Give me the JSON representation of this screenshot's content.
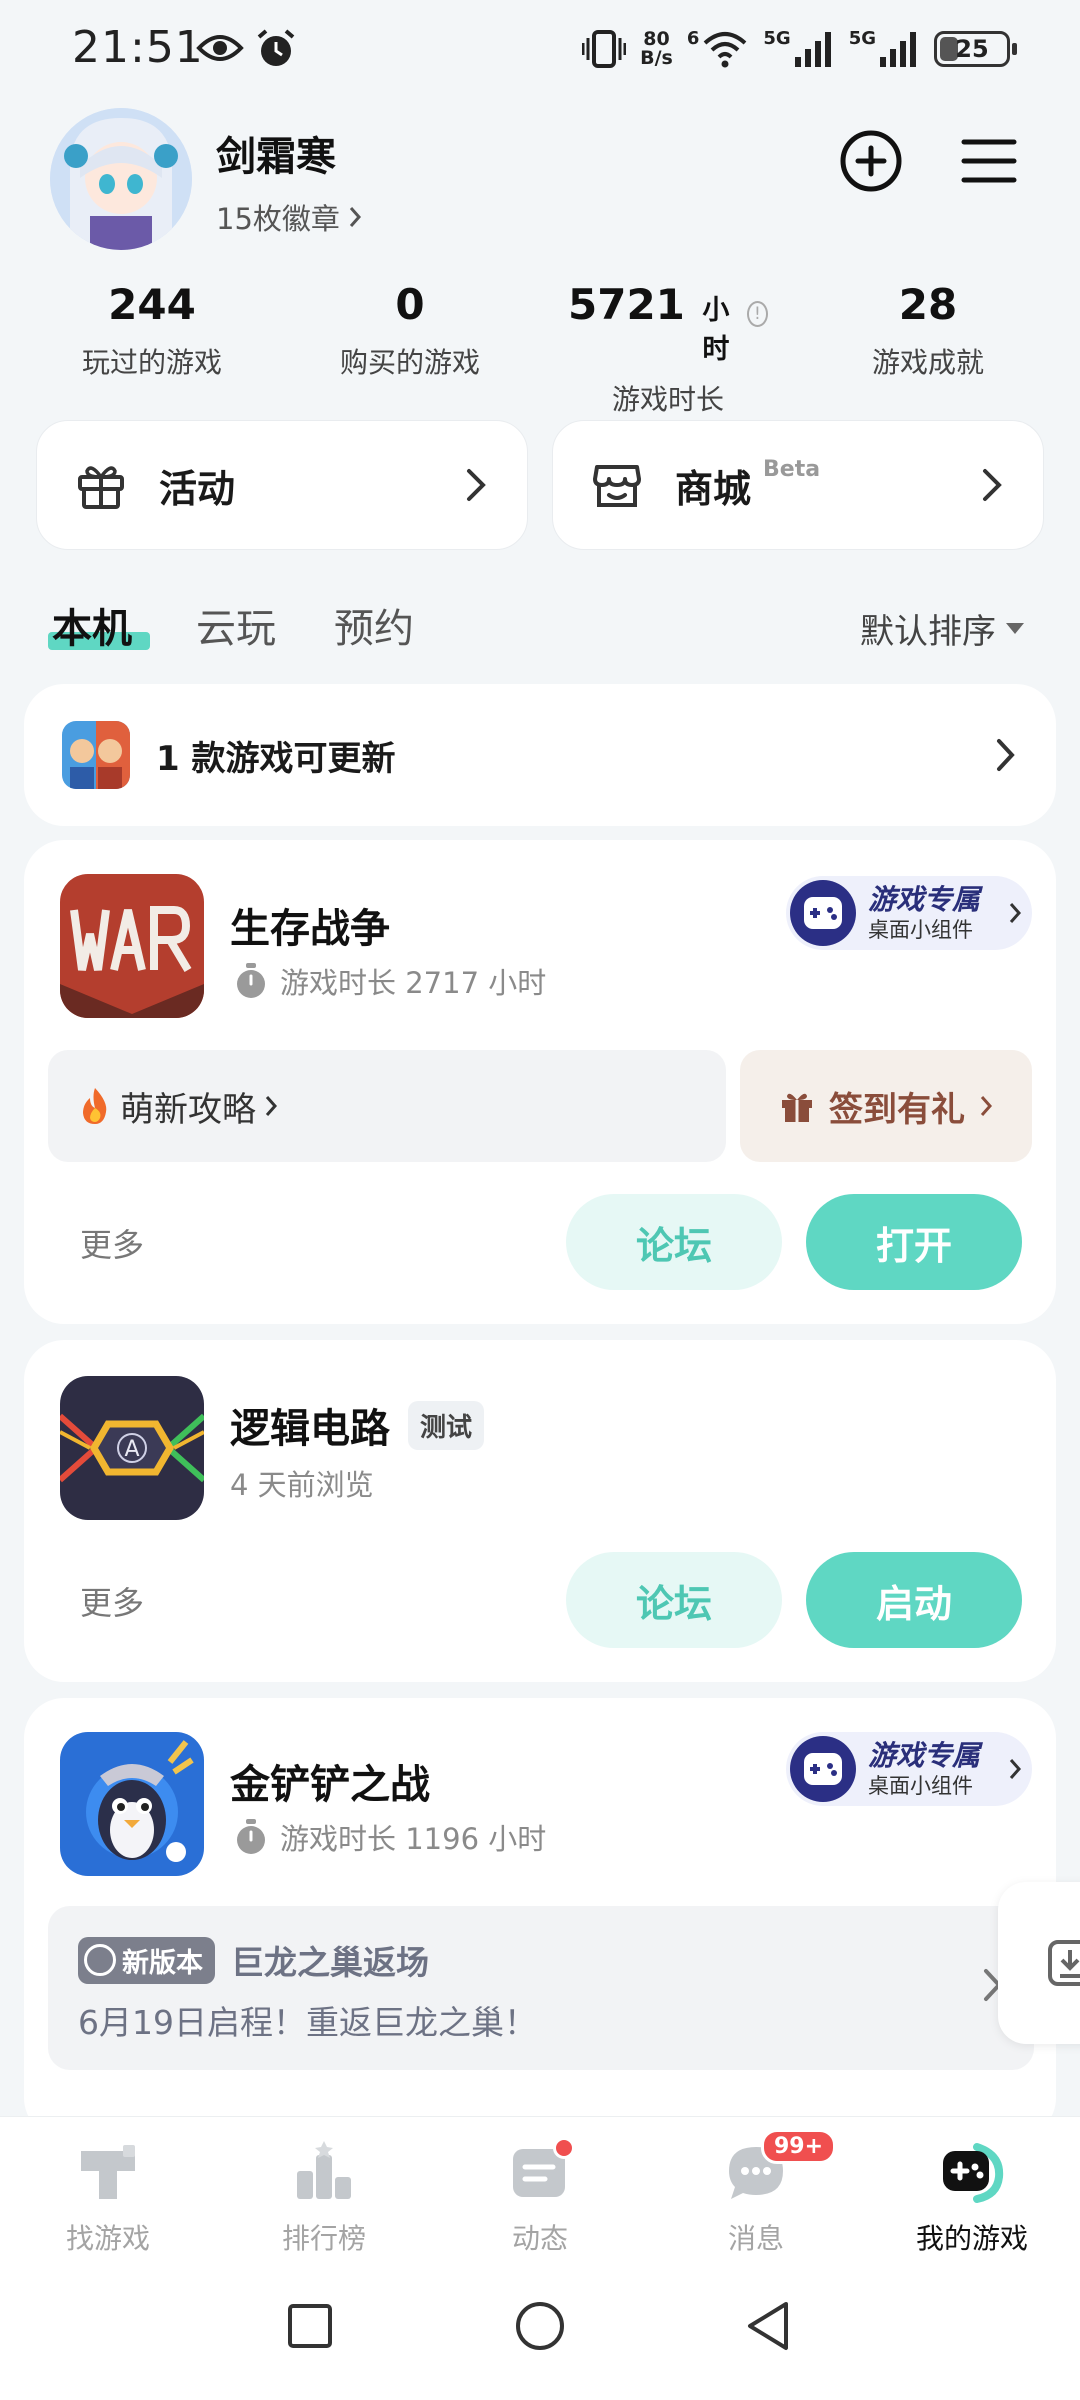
{
  "status_bar": {
    "time": "21:51",
    "net_speed_value": "80",
    "net_speed_unit": "B/s",
    "wifi_label": "6",
    "sim1_label": "5G",
    "sim2_label": "5G",
    "battery": "25"
  },
  "profile": {
    "username": "剑霜寒",
    "badges": "15枚徽章"
  },
  "stats": [
    {
      "value": "244",
      "unit": "",
      "label": "玩过的游戏"
    },
    {
      "value": "0",
      "unit": "",
      "label": "购买的游戏"
    },
    {
      "value": "5721",
      "unit": "小时",
      "label": "游戏时长"
    },
    {
      "value": "28",
      "unit": "",
      "label": "游戏成就"
    }
  ],
  "cards": {
    "activity": "活动",
    "mall": "商城",
    "mall_sup": "Beta"
  },
  "tabs": [
    "本机",
    "云玩",
    "预约"
  ],
  "sort_label": "默认排序",
  "update_row": {
    "text": "1 款游戏可更新"
  },
  "games": [
    {
      "name": "生存战争",
      "sub": "游戏时长 2717 小时",
      "widget_t1": "游戏专属",
      "widget_t2": "桌面小组件",
      "guide": "萌新攻略",
      "gift": "签到有礼",
      "more": "更多",
      "forum": "论坛",
      "action": "打开"
    },
    {
      "name": "逻辑电路",
      "tag": "测试",
      "sub": "4 天前浏览",
      "more": "更多",
      "forum": "论坛",
      "action": "启动"
    },
    {
      "name": "金铲铲之战",
      "sub": "游戏时长 1196 小时",
      "widget_t1": "游戏专属",
      "widget_t2": "桌面小组件",
      "news_tag": "新版本",
      "news_title": "巨龙之巢返场",
      "news_body": "6月19日启程！重返巨龙之巢！"
    }
  ],
  "bottom_nav": [
    {
      "label": "找游戏",
      "icon": "find-games-icon"
    },
    {
      "label": "排行榜",
      "icon": "leaderboard-icon"
    },
    {
      "label": "动态",
      "icon": "feed-icon"
    },
    {
      "label": "消息",
      "icon": "messages-icon",
      "badge": "99+"
    },
    {
      "label": "我的游戏",
      "icon": "my-games-icon"
    }
  ],
  "colors": {
    "accent": "#5fd7c3",
    "forum_bg": "#e6f8f5",
    "badge_red": "#f04f4f"
  }
}
